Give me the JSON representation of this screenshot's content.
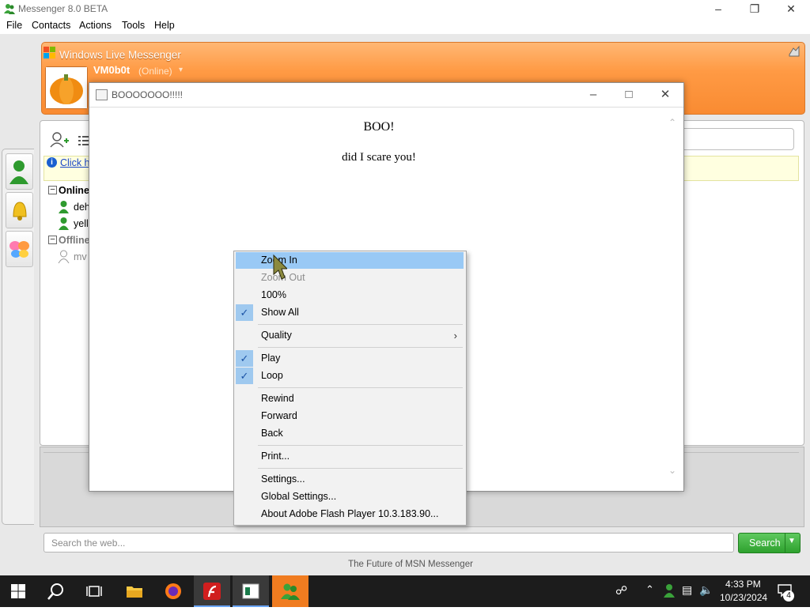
{
  "app": {
    "title": "Messenger 8.0 BETA",
    "menu": [
      "File",
      "Contacts",
      "Actions",
      "Tools",
      "Help"
    ],
    "header": {
      "product": "Windows Live Messenger",
      "user_name": "VM0b0t",
      "status": "(Online)"
    },
    "info_link": "Click h",
    "groups": [
      {
        "name": "Online",
        "contacts": [
          "deh",
          "yell"
        ]
      },
      {
        "name": "Offline",
        "contacts": [
          "mv"
        ]
      }
    ],
    "web_search_placeholder": "Search the web...",
    "search_button": "Search",
    "footer": "The Future of MSN Messenger"
  },
  "popup": {
    "title": "BOOOOOOO!!!!!",
    "heading": "BOO!",
    "subtext": "did I scare you!"
  },
  "context_menu": {
    "items": [
      {
        "label": "Zoom In",
        "highlighted": true
      },
      {
        "label": "Zoom Out",
        "disabled": true
      },
      {
        "label": "100%"
      },
      {
        "label": "Show All",
        "checked": true
      },
      {
        "label": "Quality",
        "submenu": true
      },
      {
        "label": "Play",
        "checked": true
      },
      {
        "label": "Loop",
        "checked": true
      },
      {
        "label": "Rewind"
      },
      {
        "label": "Forward"
      },
      {
        "label": "Back"
      },
      {
        "label": "Print..."
      },
      {
        "label": "Settings..."
      },
      {
        "label": "Global Settings..."
      },
      {
        "label": "About Adobe Flash Player 10.3.183.90..."
      }
    ]
  },
  "taskbar": {
    "time": "4:33 PM",
    "date": "10/23/2024",
    "notification_count": "4"
  },
  "colors": {
    "header_orange": "#f98b32",
    "highlight": "#99c9f5",
    "search_green": "#2ea12e",
    "taskbar": "#1c1c1c"
  }
}
